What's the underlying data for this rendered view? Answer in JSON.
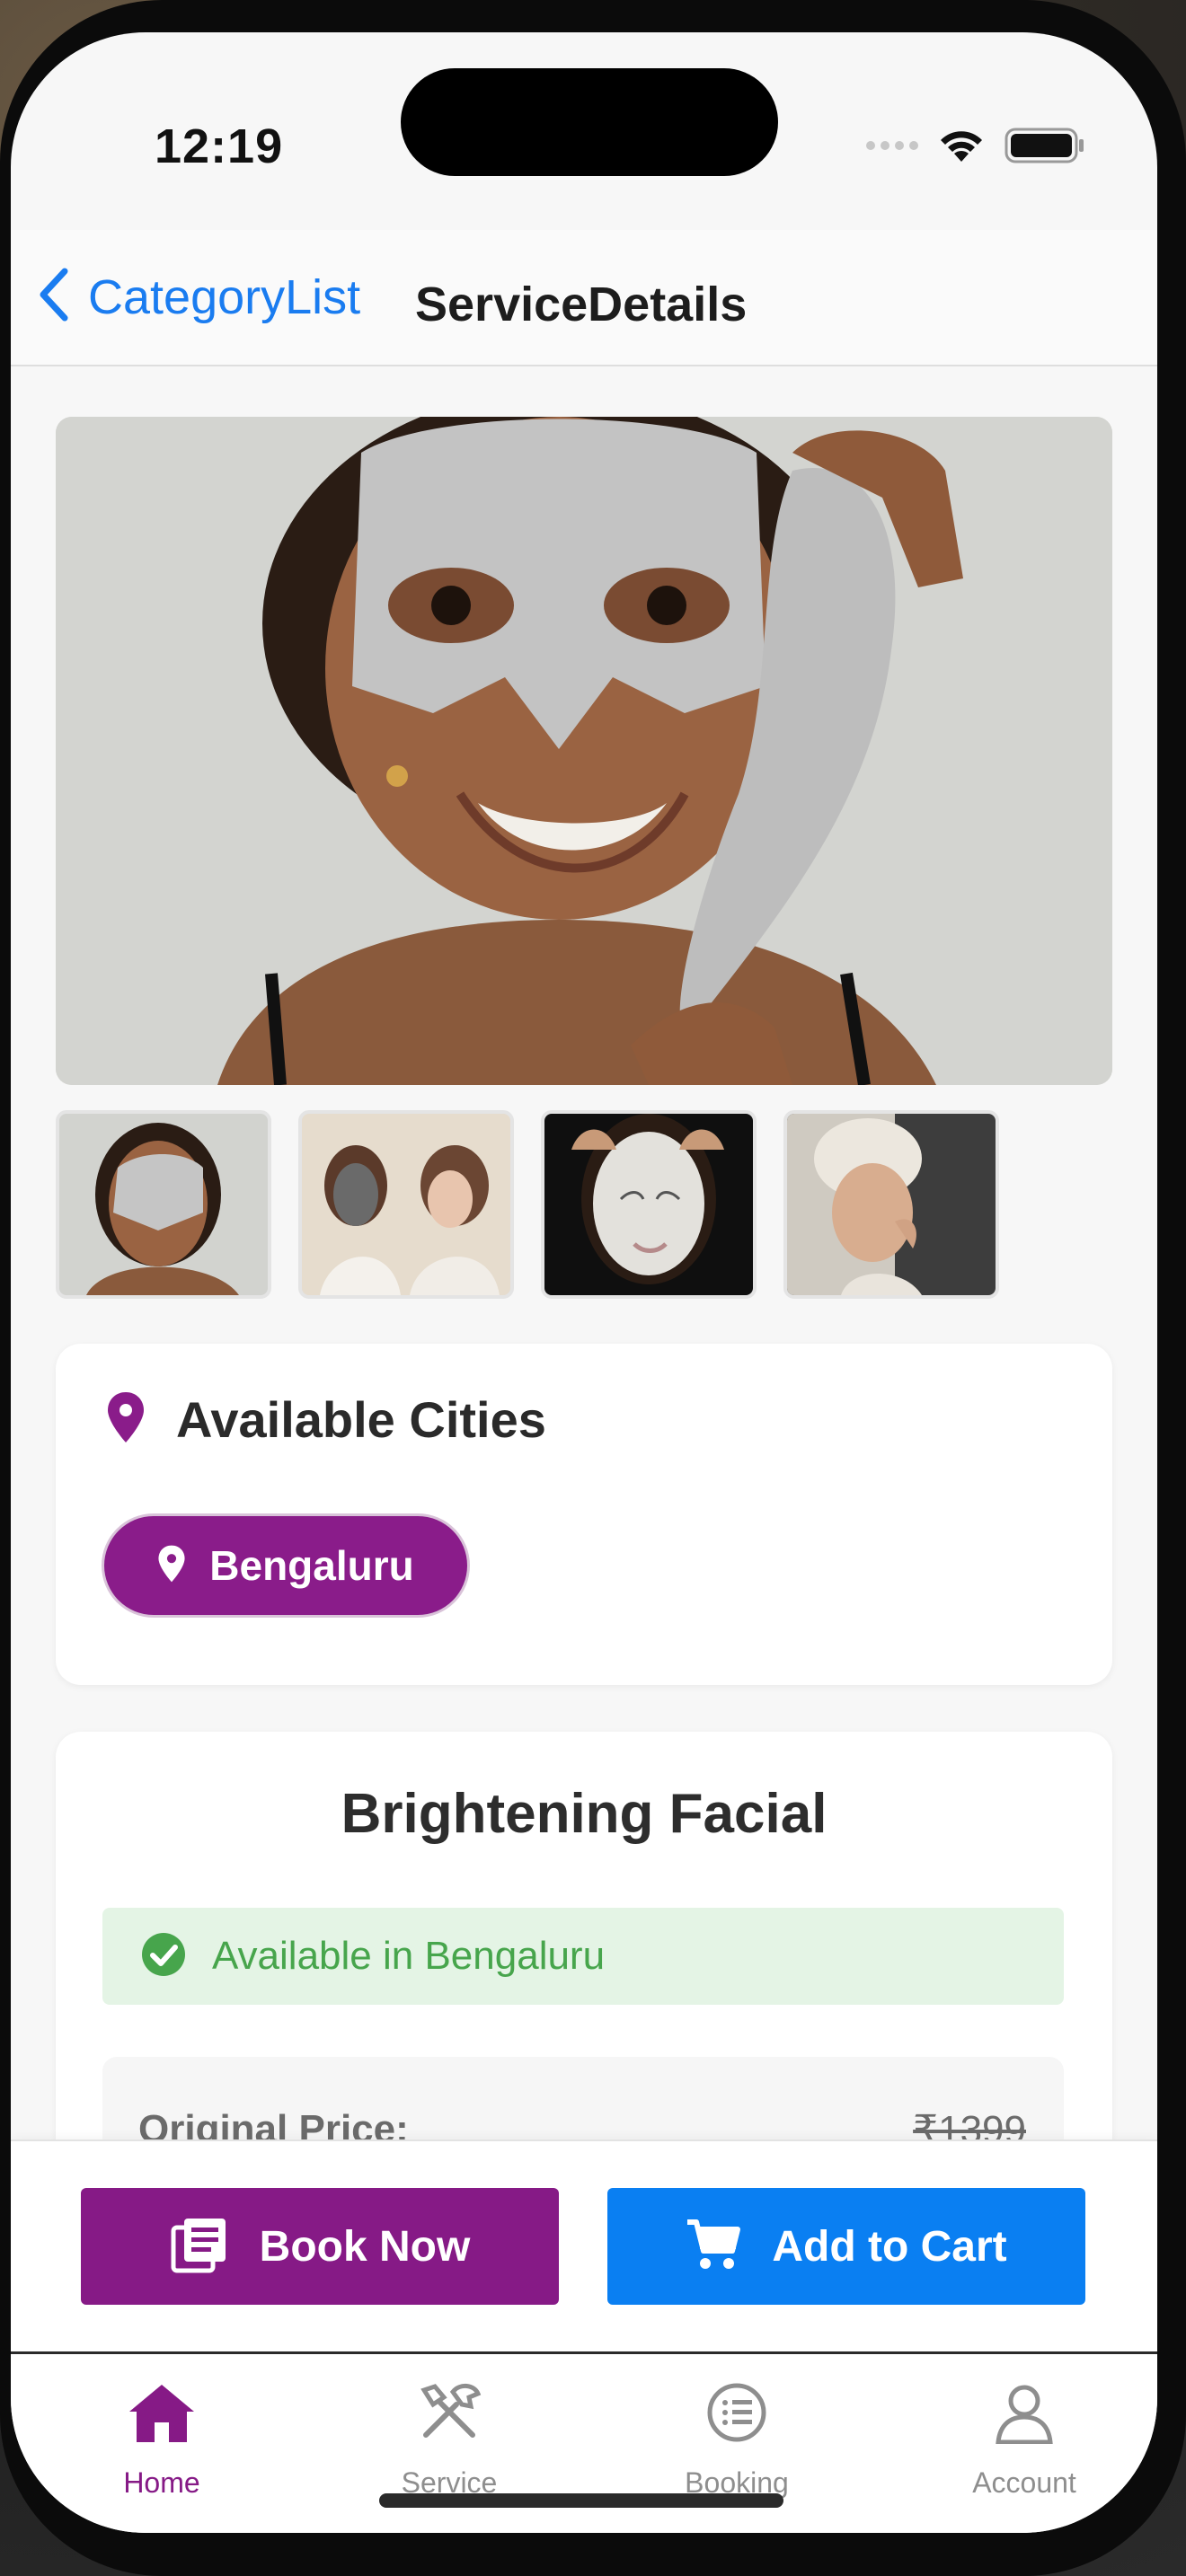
{
  "status_bar": {
    "time": "12:19"
  },
  "navbar": {
    "back_label": "CategoryList",
    "title": "ServiceDetails"
  },
  "gallery": {
    "thumbnail_count": 4
  },
  "cities": {
    "title": "Available Cities",
    "items": [
      {
        "label": "Bengaluru"
      }
    ]
  },
  "service": {
    "name": "Brightening Facial",
    "availability": "Available in Bengaluru",
    "original_price_label": "Original Price:",
    "original_price": "₹1399"
  },
  "actions": {
    "book_now": "Book Now",
    "add_to_cart": "Add to Cart"
  },
  "tabs": [
    {
      "label": "Home",
      "icon": "home-icon",
      "active": true
    },
    {
      "label": "Service",
      "icon": "tools-icon",
      "active": false
    },
    {
      "label": "Booking",
      "icon": "list-icon",
      "active": false
    },
    {
      "label": "Account",
      "icon": "person-icon",
      "active": false
    }
  ],
  "colors": {
    "accent_purple": "#861a86",
    "primary_blue": "#0a7ff2",
    "link_blue": "#1a7cf0",
    "success_green": "#47a54c",
    "success_bg": "#e4f4e5"
  }
}
